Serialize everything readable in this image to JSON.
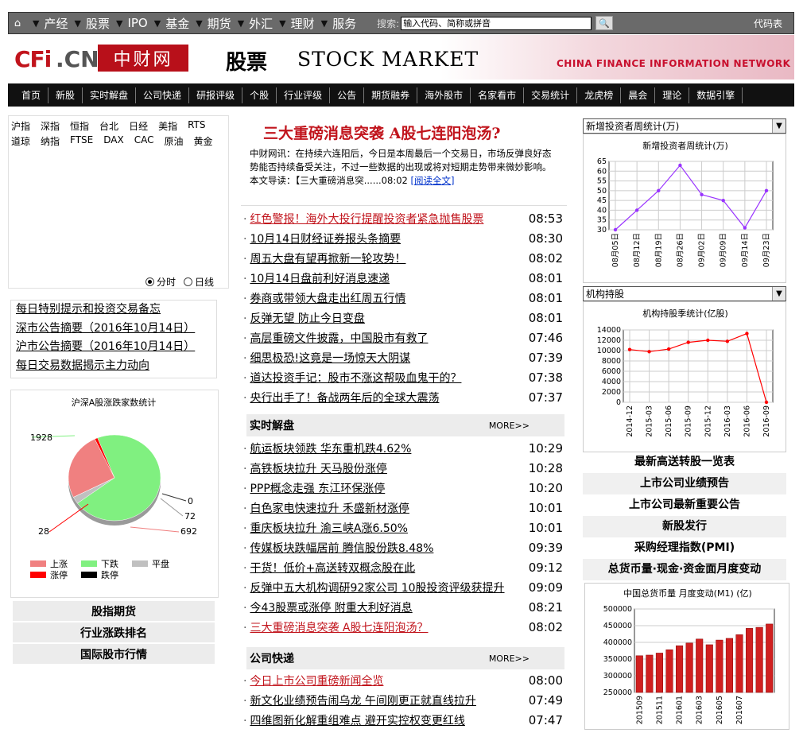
{
  "topnav": {
    "items": [
      "产经",
      "股票",
      "IPO",
      "基金",
      "期货",
      "外汇",
      "理财",
      "服务"
    ],
    "search_label": "搜索:",
    "search_placeholder": "输入代码、简称或拼音",
    "code_table": "代码表"
  },
  "banner": {
    "logo_cfi": "CFi",
    "logo_cn": ".CN",
    "logo_cn_name": "中财网",
    "section": "股票",
    "section_en": "STOCK MARKET",
    "org_en": "CHINA FINANCE INFORMATION NETWORK"
  },
  "menu": [
    "首页",
    "新股",
    "实时解盘",
    "公司快递",
    "研报评级",
    "个股",
    "行业评级",
    "公告",
    "期货融券",
    "海外股市",
    "名家看市",
    "交易统计",
    "龙虎榜",
    "晨会",
    "理论",
    "数据引擎"
  ],
  "indices": {
    "row1": [
      "沪指",
      "深指",
      "恒指",
      "台北",
      "日经",
      "美指",
      "RTS"
    ],
    "row2": [
      "道琼",
      "纳指",
      "FTSE",
      "DAX",
      "CAC",
      "原油",
      "黄金"
    ]
  },
  "radio": {
    "minute": "分时",
    "daily": "日线"
  },
  "left_links": [
    "每日特别提示和投资交易备忘",
    "深市公告摘要（2016年10月14日）",
    "沪市公告摘要（2016年10月14日）",
    "每日交易数据揭示主力动向"
  ],
  "pie": {
    "title": "沪深A股涨跌家数统计",
    "labels": {
      "down": "1928",
      "flat": "0",
      "flat2": "72",
      "up": "692",
      "limitup": "28"
    },
    "legend": [
      "上涨",
      "下跌",
      "平盘",
      "涨停",
      "跌停"
    ],
    "colors": {
      "up": "#f08080",
      "down": "#80f080",
      "flat": "#c0c0c0",
      "limitup": "#ff0000",
      "limitdown": "#000000"
    }
  },
  "left_buttons": [
    "股指期货",
    "行业涨跌排名",
    "国际股市行情"
  ],
  "headline": {
    "title": "三大重磅消息突袭 A股七连阳泡汤?",
    "intro": "中财网讯：在持续六连阳后，今日是本周最后一个交易日，市场反弹良好态势能否持续备受关注，不过一些数据的出现或将对短期走势带来微妙影响。本文导读：【三大重磅消息突......08:02",
    "read_more": "[阅读全文]"
  },
  "news_top": [
    {
      "title": "红色警报！海外大投行提醒投资者紧急抛售股票",
      "time": "08:53",
      "red": true
    },
    {
      "title": "10月14日财经证券报头条摘要",
      "time": "08:30"
    },
    {
      "title": "周五大盘有望再掀新一轮攻势！",
      "time": "08:02"
    },
    {
      "title": "10月14日盘前利好消息速递",
      "time": "08:01"
    },
    {
      "title": "券商或带领大盘走出红周五行情",
      "time": "08:01"
    },
    {
      "title": "反弹无望 防止今日变盘",
      "time": "08:01"
    },
    {
      "title": "高层重磅文件披露，中国股市有救了",
      "time": "07:46"
    },
    {
      "title": "细思极恐!这竟是一场惊天大阴谋",
      "time": "07:39"
    },
    {
      "title": "道达投资手记：股市不涨这帮吸血鬼干的？",
      "time": "07:38"
    },
    {
      "title": "央行出手了！备战两年后的全球大震荡",
      "time": "07:37"
    }
  ],
  "section_realtime": {
    "title": "实时解盘",
    "more": "MORE>>"
  },
  "news_realtime": [
    {
      "title": "航运板块领跌 华东重机跌4.62%",
      "time": "10:29"
    },
    {
      "title": "高铁板块拉升 天马股份涨停",
      "time": "10:28"
    },
    {
      "title": "PPP概念走强 东江环保涨停",
      "time": "10:20"
    },
    {
      "title": "白色家电快速拉升 禾盛新材涨停",
      "time": "10:01"
    },
    {
      "title": "重庆板块拉升 渝三峡A涨6.50%",
      "time": "10:01"
    },
    {
      "title": "传媒板块跌幅居前 腾信股份跌8.48%",
      "time": "09:39"
    },
    {
      "title": "干货！低价+高送转双概念股在此",
      "time": "09:12"
    },
    {
      "title": "反弹中五大机构调研92家公司 10股投资评级获提升",
      "time": "09:09"
    },
    {
      "title": "今43股票或涨停 附重大利好消息",
      "time": "08:21"
    },
    {
      "title": "三大重磅消息突袭 A股七连阳泡汤？",
      "time": "08:02",
      "red": true
    }
  ],
  "section_company": {
    "title": "公司快递",
    "more": "MORE>>"
  },
  "news_company": [
    {
      "title": "今日上市公司重磅新闻全览",
      "time": "08:00",
      "red": true
    },
    {
      "title": "新文化业绩预告闹乌龙 午间刚更正就直线拉升",
      "time": "07:49"
    },
    {
      "title": "四维图新化解重组难点 避开实控权变更红线",
      "time": "07:47"
    }
  ],
  "right": {
    "select1": "新增投资者周统计(万)",
    "select2": "机构持股",
    "links": [
      "最新高送转股一览表",
      "上市公司业绩预告",
      "上市公司最新重要公告",
      "新股发行",
      "采购经理指数(PMI)",
      "总货币量·现金·资金面月度变动"
    ]
  },
  "chart_data": [
    {
      "type": "line",
      "title": "新增投资者周统计(万)",
      "x": [
        "08月05日",
        "08月12日",
        "08月19日",
        "08月26日",
        "09月02日",
        "09月09日",
        "09月14日",
        "09月23日"
      ],
      "values": [
        30,
        40,
        50,
        63,
        48,
        45,
        31,
        50
      ],
      "ylim": [
        30,
        65
      ],
      "yticks": [
        30,
        35,
        40,
        45,
        50,
        55,
        60,
        65
      ],
      "color": "#9933ff"
    },
    {
      "type": "line",
      "title": "机构持股季统计(亿股)",
      "x": [
        "2014-12",
        "2015-03",
        "2015-06",
        "2015-09",
        "2015-12",
        "2016-03",
        "2016-06",
        "2016-09"
      ],
      "values": [
        10200,
        9800,
        10300,
        11600,
        12000,
        11800,
        13300,
        0
      ],
      "ylim": [
        0,
        14000
      ],
      "yticks": [
        0,
        2000,
        4000,
        6000,
        8000,
        10000,
        12000,
        14000
      ],
      "color": "#ff0000"
    },
    {
      "type": "bar",
      "title": "中国总货币量 月度变动(M1) (亿)",
      "x": [
        "201509",
        "201511",
        "201601",
        "201603",
        "201605",
        "201607"
      ],
      "values": [
        360000,
        362000,
        368000,
        378000,
        390000,
        398000,
        410000,
        393000,
        407000,
        412000,
        423000,
        442000,
        445000,
        455000
      ],
      "ylim": [
        250000,
        500000
      ],
      "yticks": [
        250000,
        300000,
        350000,
        400000,
        450000,
        500000
      ],
      "color": "#d02020"
    },
    {
      "type": "pie",
      "title": "沪深A股涨跌家数统计",
      "categories": [
        "下跌",
        "平盘",
        "跌停",
        "上涨",
        "涨停"
      ],
      "values": [
        1928,
        72,
        0,
        692,
        28
      ]
    }
  ]
}
